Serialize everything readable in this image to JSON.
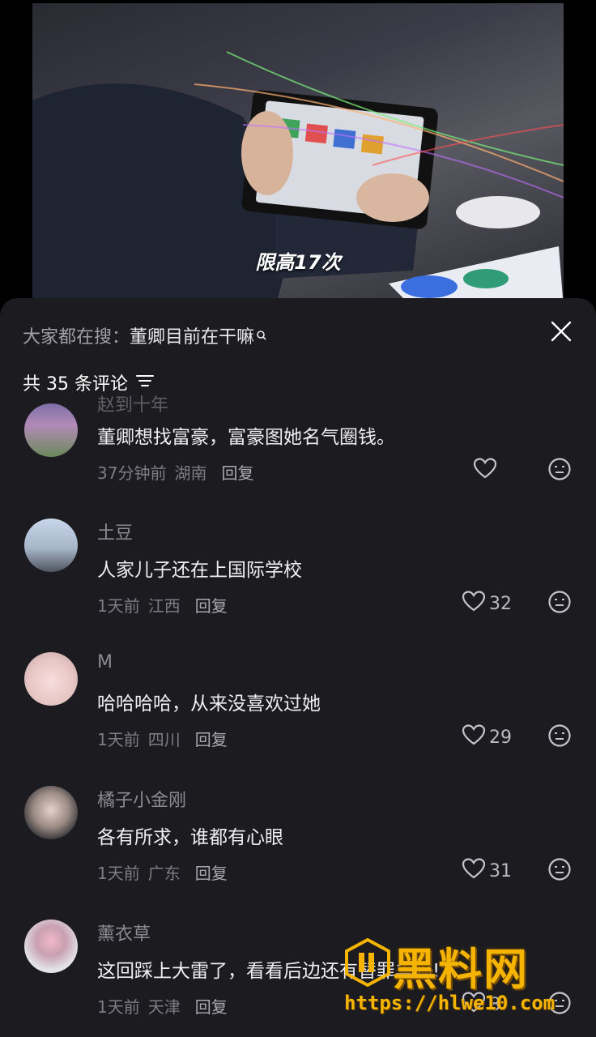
{
  "video": {
    "caption": "限高17次"
  },
  "header": {
    "search_prefix": "大家都在搜：",
    "search_term": "董卿目前在干嘛",
    "comment_count": "共 35 条评论"
  },
  "comments": [
    {
      "name": "赵到十年",
      "text": "董卿想找富豪，富豪图她名气圈钱。",
      "time": "37分钟前",
      "region": "湖南",
      "reply": "回复",
      "likes": ""
    },
    {
      "name": "土豆",
      "text": "人家儿子还在上国际学校",
      "time": "1天前",
      "region": "江西",
      "reply": "回复",
      "likes": "32"
    },
    {
      "name": "M",
      "text": "哈哈哈哈，从来没喜欢过她",
      "time": "1天前",
      "region": "四川",
      "reply": "回复",
      "likes": "29"
    },
    {
      "name": "橘子小金刚",
      "text": "各有所求，谁都有心眼",
      "time": "1天前",
      "region": "广东",
      "reply": "回复",
      "likes": "31"
    },
    {
      "name": "薰衣草",
      "text": "这回踩上大雷了，看看后边还有替罪羊吗!",
      "time": "1天前",
      "region": "天津",
      "reply": "回复",
      "likes": "8"
    }
  ],
  "watermark": {
    "title": "黑料网",
    "url": "https://hlwe10.com"
  },
  "colors": {
    "sheet_bg": "#1c1c20",
    "accent_watermark": "#f5b400"
  }
}
